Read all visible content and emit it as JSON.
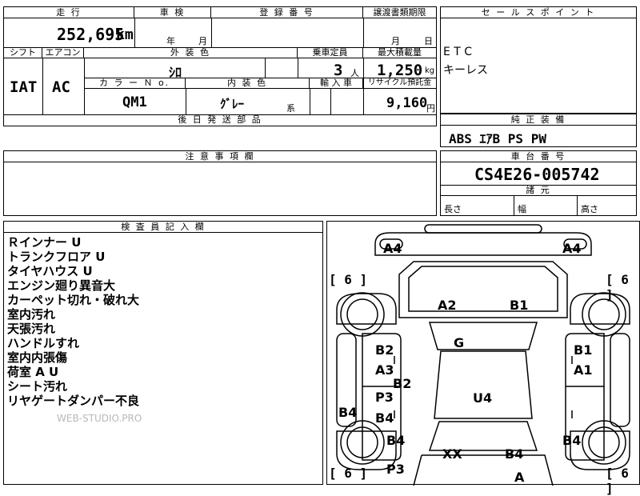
{
  "top_table": {
    "labels": {
      "mileage": "走 行",
      "inspection": "車 検",
      "registration": "登 録 番 号",
      "transfer_deadline": "譲渡書類期限",
      "shift": "シフト",
      "aircon": "エアコン",
      "exterior_color": "外 装 色",
      "capacity": "乗車定員",
      "max_load": "最大積載量",
      "color_no": "カ ラ ー Ｎ o.",
      "interior_color": "内 装 色",
      "import": "輸 入 車",
      "recycle": "リサイクル預託金",
      "later_parts": "後 日 発 送 部 品"
    },
    "values": {
      "mileage": "252,695",
      "mileage_unit": "km",
      "inspection_year": "年",
      "inspection_month": "月",
      "transfer_month": "月",
      "transfer_day": "日",
      "shift": "IAT",
      "aircon": "AC",
      "exterior_color": "ｼﾛ",
      "capacity": "3",
      "capacity_unit": "人",
      "max_load": "1,250",
      "max_load_unit": "kg",
      "color_no": "QM1",
      "interior_color": "ｸﾞﾚｰ",
      "interior_suffix": "系",
      "recycle": "9,160",
      "recycle_unit": "円"
    }
  },
  "sales_points": {
    "label": "セ ー ル ス ポ イ ン ト",
    "items": [
      "E T C",
      "キーレス"
    ]
  },
  "equipment": {
    "label": "純 正 装 備",
    "value": "ABS ｴｱB PS PW"
  },
  "notes_field": {
    "label": "注 意 事 項 欄"
  },
  "chassis": {
    "label": "車 台 番 号",
    "value": "CS4E26-005742"
  },
  "dimensions": {
    "label": "諸 元",
    "length": "長さ",
    "width": "幅",
    "height": "高さ"
  },
  "inspector": {
    "label": "検 査 員 記 入 欄",
    "lines": [
      "Ｒインナー U",
      "トランクフロア U",
      "タイヤハウス U",
      "エンジン廻り異音大",
      "カーペット切れ・破れ大",
      "室内汚れ",
      "天張汚れ",
      "ハンドルすれ",
      "室内内張傷",
      "荷室 A U",
      "シート汚れ",
      "リヤゲートダンパー不良"
    ],
    "watermark": "WEB-STUDIO.PRO"
  },
  "damage_map": {
    "tire_label": "[ 6 ]",
    "marks": {
      "front_left_corner": "A4",
      "front_right_corner": "A4",
      "hood_left": "A2",
      "hood_right": "B1",
      "windshield": "G",
      "left_front_upper": "B2",
      "left_front_lower": "A3",
      "left_front_mid": "B2",
      "right_front_upper": "B1",
      "right_front_lower": "A1",
      "left_rear_door_upper": "P3",
      "left_rear_door_lower": "B4",
      "left_sill": "B4",
      "roof": "U4",
      "left_rear_quarter": "B4",
      "right_rear_quarter": "B4",
      "rear_left": "XX",
      "rear_right": "B4",
      "rear_bottom_left": "P3",
      "rear_bottom_a": "A"
    }
  }
}
